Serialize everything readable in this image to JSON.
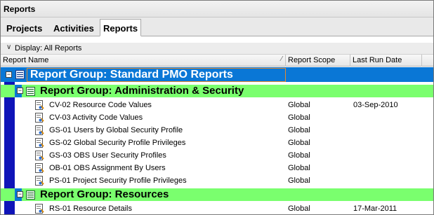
{
  "window": {
    "title": "Reports"
  },
  "tabs": [
    {
      "label": "Projects",
      "active": false
    },
    {
      "label": "Activities",
      "active": false
    },
    {
      "label": "Reports",
      "active": true
    }
  ],
  "display_bar": {
    "label": "Display: All Reports"
  },
  "columns": {
    "name": "Report Name",
    "scope": "Report Scope",
    "last_run": "Last Run Date"
  },
  "colors": {
    "top_group": "#0a77d6",
    "sub_group": "#7aff6e",
    "gutter": "#0f14b8",
    "selection_border": "#e58a2e"
  },
  "top_group": {
    "title": "Report Group: Standard PMO Reports",
    "expanded": true
  },
  "groups": [
    {
      "title": "Report Group: Administration & Security",
      "expanded": true,
      "reports": [
        {
          "name": "CV-02  Resource Code Values",
          "scope": "Global",
          "last_run": "03-Sep-2010"
        },
        {
          "name": "CV-03  Activity Code Values",
          "scope": "Global",
          "last_run": ""
        },
        {
          "name": "GS-01 Users by Global Security Profile",
          "scope": "Global",
          "last_run": ""
        },
        {
          "name": "GS-02 Global Security Profile Privileges",
          "scope": "Global",
          "last_run": ""
        },
        {
          "name": "GS-03 OBS User Security Profiles",
          "scope": "Global",
          "last_run": ""
        },
        {
          "name": "OB-01 OBS Assignment By Users",
          "scope": "Global",
          "last_run": ""
        },
        {
          "name": "PS-01 Project Security Profile Privileges",
          "scope": "Global",
          "last_run": ""
        }
      ]
    },
    {
      "title": "Report Group: Resources",
      "expanded": true,
      "reports": [
        {
          "name": "RS-01  Resource Details",
          "scope": "Global",
          "last_run": "17-Mar-2011"
        }
      ]
    }
  ]
}
